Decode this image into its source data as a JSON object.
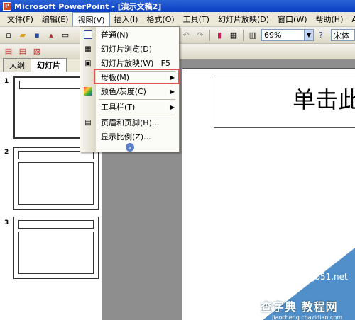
{
  "window": {
    "title": "Microsoft PowerPoint - [演示文稿2]"
  },
  "menu": {
    "items": [
      "文件(F)",
      "编辑(E)",
      "视图(V)",
      "插入(I)",
      "格式(O)",
      "工具(T)",
      "幻灯片放映(D)",
      "窗口(W)",
      "帮助(H)",
      "Adobe"
    ],
    "active": "视图(V)"
  },
  "toolbar": {
    "zoom": "69%",
    "font": "宋体"
  },
  "panel": {
    "tabs": [
      "大纲",
      "幻灯片"
    ],
    "active_tab": "幻灯片",
    "slide_numbers": [
      "1",
      "2",
      "3"
    ]
  },
  "slide": {
    "title_text": "单击此"
  },
  "dropdown": {
    "items": [
      {
        "label": "普通(N)",
        "shortcut": "",
        "submenu": false,
        "icon": "normal-view-icon"
      },
      {
        "label": "幻灯片浏览(D)",
        "shortcut": "",
        "submenu": false,
        "icon": "slide-sorter-icon"
      },
      {
        "label": "幻灯片放映(W)",
        "shortcut": "F5",
        "submenu": false,
        "icon": "slideshow-icon"
      },
      {
        "label": "母板(M)",
        "shortcut": "",
        "submenu": true,
        "icon": ""
      },
      {
        "label": "颜色/灰度(C)",
        "shortcut": "",
        "submenu": true,
        "icon": "color-grayscale-icon"
      },
      {
        "label": "工具栏(T)",
        "shortcut": "",
        "submenu": true,
        "icon": ""
      },
      {
        "label": "页眉和页脚(H)...",
        "shortcut": "",
        "submenu": false,
        "icon": "header-footer-icon"
      },
      {
        "label": "显示比例(Z)...",
        "shortcut": "",
        "submenu": false,
        "icon": ""
      }
    ],
    "highlighted": "母板(M)"
  },
  "watermark": {
    "line1": "jb51.net",
    "line2": "查字典 教程网",
    "line3": "jiaocheng.chazidian.com"
  }
}
